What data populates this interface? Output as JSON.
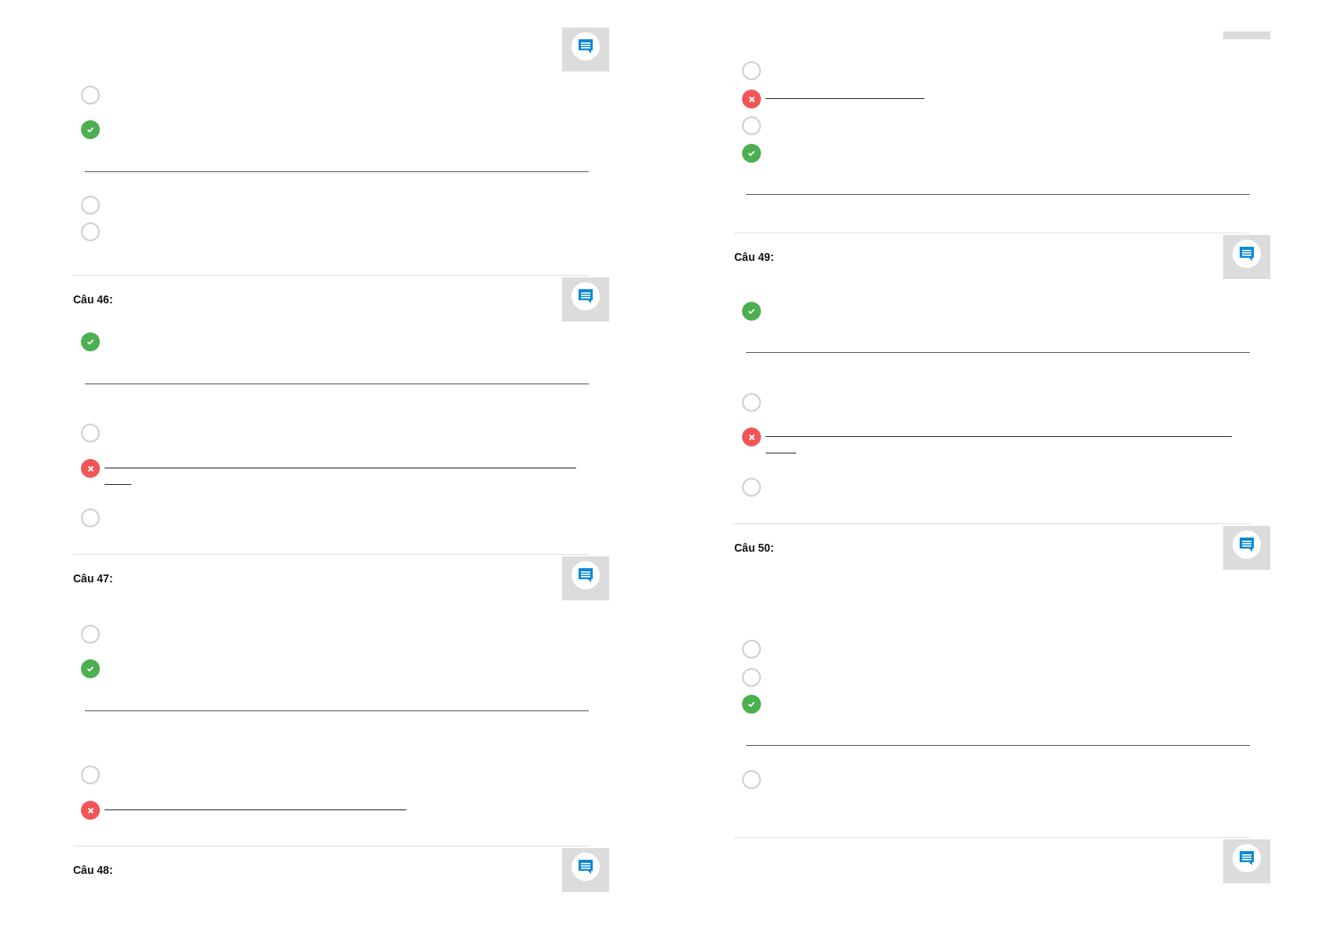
{
  "columns": [
    {
      "blocks": [
        {
          "kind": "header"
        },
        {
          "kind": "option",
          "checked": false
        },
        {
          "kind": "option",
          "checked": true,
          "correct": true
        },
        {
          "kind": "rule"
        },
        {
          "kind": "option",
          "checked": false
        },
        {
          "kind": "option",
          "checked": false
        },
        {
          "kind": "header",
          "label": "Câu 46:"
        },
        {
          "kind": "option",
          "checked": true,
          "correct": true
        },
        {
          "kind": "rule"
        },
        {
          "kind": "option",
          "checked": false
        },
        {
          "kind": "option",
          "checked": true,
          "correct": false
        },
        {
          "kind": "option",
          "checked": false
        },
        {
          "kind": "header",
          "label": "Câu 47:"
        },
        {
          "kind": "option",
          "checked": false
        },
        {
          "kind": "option",
          "checked": true,
          "correct": true
        },
        {
          "kind": "rule"
        },
        {
          "kind": "option",
          "checked": false
        },
        {
          "kind": "option",
          "checked": true,
          "correct": false
        },
        {
          "kind": "header",
          "label": "Câu 48:"
        }
      ]
    },
    {
      "blocks": [
        {
          "kind": "button_edge"
        },
        {
          "kind": "option",
          "checked": false
        },
        {
          "kind": "option",
          "checked": true,
          "correct": false
        },
        {
          "kind": "option",
          "checked": false
        },
        {
          "kind": "option",
          "checked": true,
          "correct": true
        },
        {
          "kind": "rule"
        },
        {
          "kind": "header",
          "label": "Câu 49:"
        },
        {
          "kind": "option",
          "checked": true,
          "correct": true
        },
        {
          "kind": "rule"
        },
        {
          "kind": "option",
          "checked": false
        },
        {
          "kind": "option",
          "checked": true,
          "correct": false
        },
        {
          "kind": "option",
          "checked": false
        },
        {
          "kind": "header",
          "label": "Câu 50:"
        },
        {
          "kind": "option",
          "checked": false
        },
        {
          "kind": "option",
          "checked": false
        },
        {
          "kind": "option",
          "checked": true,
          "correct": true
        },
        {
          "kind": "rule"
        },
        {
          "kind": "option",
          "checked": false
        },
        {
          "kind": "header"
        }
      ]
    }
  ]
}
